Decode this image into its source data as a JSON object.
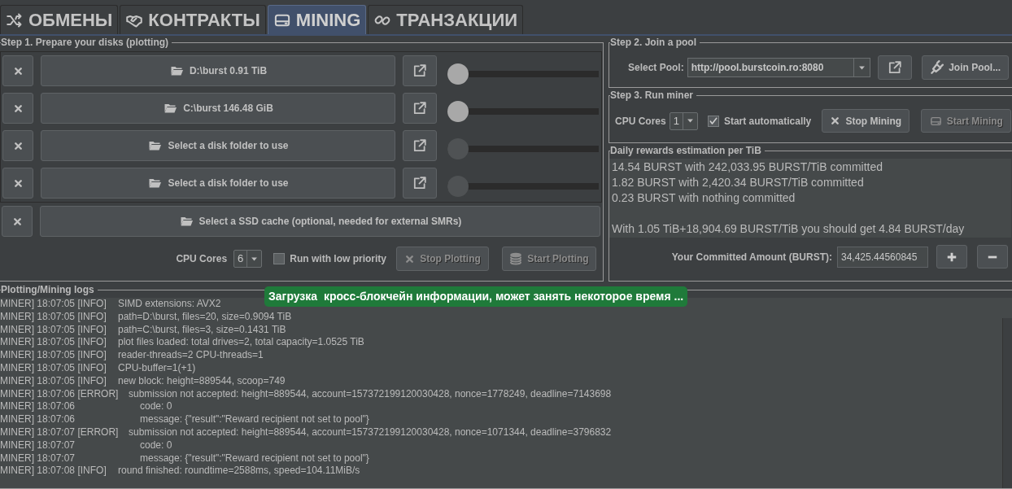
{
  "tabs": [
    {
      "label": "ОБМЕНЫ",
      "selected": false
    },
    {
      "label": "КОНТРАКТЫ",
      "selected": false
    },
    {
      "label": "MINING",
      "selected": true
    },
    {
      "label": "ТРАНЗАКЦИИ",
      "selected": false
    }
  ],
  "step1": {
    "title": "Step 1. Prepare your disks (plotting)",
    "disks": [
      {
        "label": "D:\\burst 0.91 TiB",
        "enabled": true,
        "level": 0
      },
      {
        "label": "C:\\burst 146.48 GiB",
        "enabled": true,
        "level": 0
      },
      {
        "label": "Select a disk folder to use",
        "enabled": false,
        "level": 0
      },
      {
        "label": "Select a disk folder to use",
        "enabled": false,
        "level": 0
      }
    ],
    "ssd_cache": "Select a SSD cache (optional, needed for external SMRs)",
    "cpu_cores_label": "CPU Cores",
    "cpu_cores": "6",
    "low_priority": {
      "label": "Run with low priority",
      "checked": false
    },
    "stop_button": {
      "label": "Stop Plotting",
      "disabled": true
    },
    "start_button": {
      "label": "Start Plotting",
      "disabled": true
    }
  },
  "step2": {
    "title": "Step 2. Join a pool",
    "select_pool_label": "Select Pool:",
    "pool": "http://pool.burstcoin.ro:8080",
    "join_button": "Join Pool..."
  },
  "step3": {
    "title": "Step 3. Run miner",
    "cpu_cores_label": "CPU Cores",
    "cpu_cores": "1",
    "start_automatically": {
      "label": "Start automatically",
      "checked": true
    },
    "stop_button": {
      "label": "Stop Mining",
      "disabled": false
    },
    "start_button": {
      "label": "Start Mining",
      "disabled": true
    }
  },
  "rewards": {
    "title": "Daily rewards estimation per TiB",
    "lines": [
      "14.54 BURST with 242,033.95 BURST/TiB committed",
      "1.82 BURST with 2,420.34 BURST/TiB committed",
      "0.23 BURST with nothing committed",
      "With 1.05 TiB+18,904.69 BURST/TiB you should get 4.84 BURST/day"
    ],
    "committed_label": "Your Committed Amount (BURST):",
    "committed_value": "34,425.44560845"
  },
  "logs": {
    "title": "Plotting/Mining logs",
    "lines": [
      {
        "kind": "info",
        "prefix": "MINER] 18:07:05 [INFO]",
        "message": "SIMD extensions: AVX2"
      },
      {
        "kind": "info",
        "prefix": "MINER] 18:07:05 [INFO]",
        "message": "path=D:\\burst, files=20, size=0.9094 TiB"
      },
      {
        "kind": "info",
        "prefix": "MINER] 18:07:05 [INFO]",
        "message": "path=C:\\burst, files=3, size=0.1431 TiB"
      },
      {
        "kind": "info",
        "prefix": "MINER] 18:07:05 [INFO]",
        "message": "plot files loaded: total drives=2, total capacity=1.0525 TiB"
      },
      {
        "kind": "info",
        "prefix": "MINER] 18:07:05 [INFO]",
        "message": "reader-threads=2 CPU-threads=1"
      },
      {
        "kind": "info",
        "prefix": "MINER] 18:07:05 [INFO]",
        "message": "CPU-buffer=1(+1)"
      },
      {
        "kind": "info",
        "prefix": "MINER] 18:07:05 [INFO]",
        "message": "new block: height=889544, scoop=749"
      },
      {
        "kind": "error",
        "prefix": "MINER] 18:07:06 [ERROR]",
        "message": "submission not accepted: height=889544, account=157372199120030428, nonce=1778249, deadline=7143698"
      },
      {
        "kind": "detail",
        "prefix": "MINER] 18:07:06",
        "message": "code: 0"
      },
      {
        "kind": "detail",
        "prefix": "MINER] 18:07:06",
        "message": "message: {\"result\":\"Reward recipient not set to pool\"}"
      },
      {
        "kind": "error",
        "prefix": "MINER] 18:07:07 [ERROR]",
        "message": "submission not accepted: height=889544, account=157372199120030428, nonce=1071344, deadline=3796832"
      },
      {
        "kind": "detail",
        "prefix": "MINER] 18:07:07",
        "message": "code: 0"
      },
      {
        "kind": "detail",
        "prefix": "MINER] 18:07:07",
        "message": "message: {\"result\":\"Reward recipient not set to pool\"}"
      },
      {
        "kind": "info",
        "prefix": "MINER] 18:07:08 [INFO]",
        "message": "round finished: roundtime=2588ms, speed=104.11MiB/s"
      }
    ]
  },
  "toast": "Загрузка  кросс-блокчейн информации, может занять некоторое время ..."
}
